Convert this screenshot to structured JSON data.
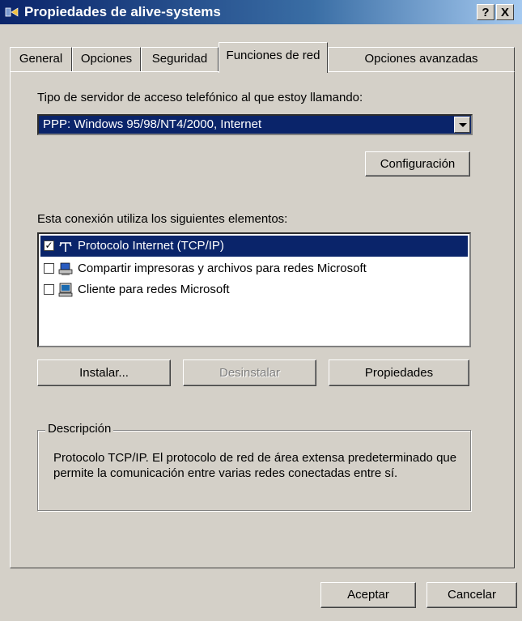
{
  "window": {
    "title": "Propiedades de alive-systems",
    "help_button": "?",
    "close_button": "X"
  },
  "tabs": [
    {
      "label": "General"
    },
    {
      "label": "Opciones"
    },
    {
      "label": "Seguridad"
    },
    {
      "label": "Funciones de red",
      "active": true
    },
    {
      "label": "Opciones avanzadas"
    }
  ],
  "server_type": {
    "label": "Tipo de servidor de acceso telefónico al que estoy llamando:",
    "selected": "PPP: Windows 95/98/NT4/2000, Internet",
    "config_button": "Configuración"
  },
  "components": {
    "label": "Esta conexión utiliza los siguientes elementos:",
    "items": [
      {
        "label": "Protocolo Internet (TCP/IP)",
        "checked": true,
        "selected": true,
        "icon": "network-protocol-icon"
      },
      {
        "label": "Compartir impresoras y archivos para redes Microsoft",
        "checked": false,
        "selected": false,
        "icon": "printer-share-icon"
      },
      {
        "label": "Cliente para redes Microsoft",
        "checked": false,
        "selected": false,
        "icon": "client-computer-icon"
      }
    ],
    "install_button": "Instalar...",
    "uninstall_button": "Desinstalar",
    "properties_button": "Propiedades"
  },
  "description": {
    "legend": "Descripción",
    "text": "Protocolo TCP/IP. El protocolo de red de área extensa predeterminado que permite la comunicación entre varias redes conectadas entre sí."
  },
  "footer": {
    "ok_button": "Aceptar",
    "cancel_button": "Cancelar"
  }
}
